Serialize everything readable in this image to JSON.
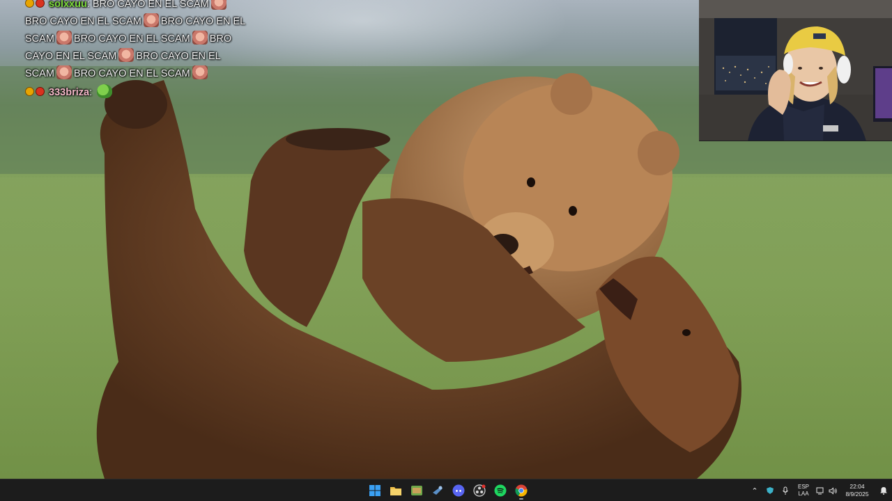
{
  "chat": {
    "messages": [
      {
        "username": "solxxuu",
        "username_color": "#7ddc3c",
        "badges": [
          "gold-badge",
          "red-badge"
        ],
        "segments": [
          "BRO CAYO EN EL SCAM",
          "BRO CAYO EN EL SCAM",
          "BRO CAYO EN EL SCAM",
          "BRO CAYO EN EL SCAM",
          "BRO CAYO EN EL SCAM",
          "BRO CAYO EN EL SCAM",
          "BRO CAYO EN EL SCAM"
        ],
        "emote": "face-emote"
      },
      {
        "username": "333briza",
        "username_color": "#f4b8c8",
        "badges": [
          "gold-badge",
          "red-badge"
        ],
        "segments": [],
        "emote": "pepe-emote"
      }
    ]
  },
  "taskbar": {
    "apps": [
      {
        "name": "start-button",
        "icon": "windows-logo-icon",
        "color": "#3aa0f3",
        "active": false
      },
      {
        "name": "taskbar-file-explorer",
        "icon": "folder-icon",
        "color": "#f2c24a",
        "active": false
      },
      {
        "name": "taskbar-app-green",
        "icon": "green-window-icon",
        "color": "#6fa84a",
        "active": false
      },
      {
        "name": "taskbar-steam",
        "icon": "steam-icon",
        "color": "#5a8fc7",
        "active": false
      },
      {
        "name": "taskbar-discord",
        "icon": "discord-icon",
        "color": "#5865f2",
        "active": false
      },
      {
        "name": "taskbar-obs",
        "icon": "obs-icon",
        "color": "#d8d8d8",
        "active": false
      },
      {
        "name": "taskbar-spotify",
        "icon": "spotify-icon",
        "color": "#1ed760",
        "active": false
      },
      {
        "name": "taskbar-chrome",
        "icon": "chrome-icon",
        "color": "#4285f4",
        "active": true
      }
    ],
    "tray": {
      "language_top": "ESP",
      "language_bottom": "LAA",
      "time": "22:04",
      "date": "8/9/2025"
    }
  },
  "colors": {
    "taskbar_bg": "#1c1c1c",
    "chat_text": "#f2f2f2"
  }
}
